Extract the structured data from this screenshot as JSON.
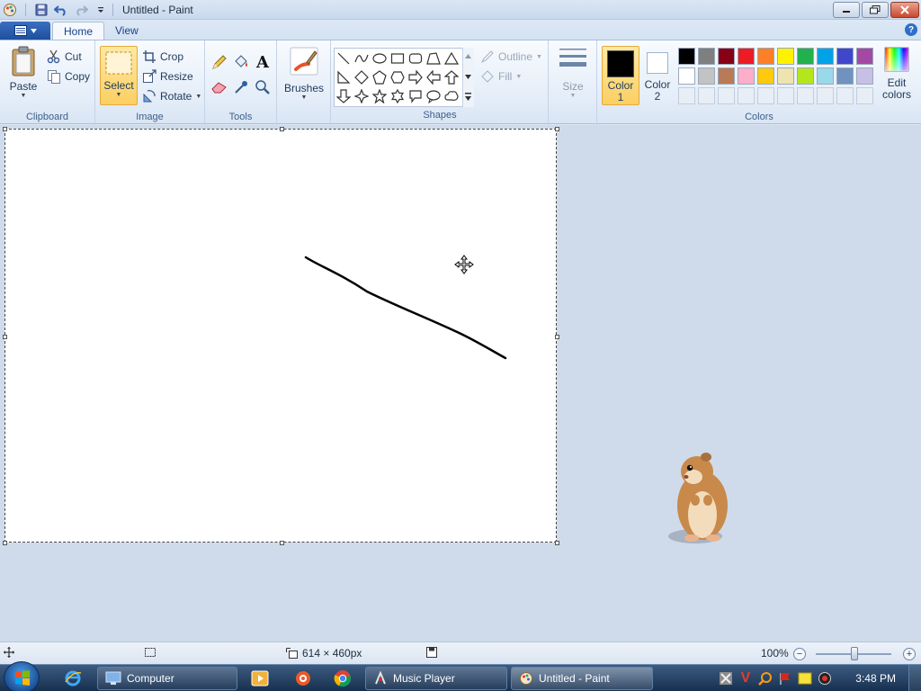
{
  "window": {
    "title": "Untitled - Paint"
  },
  "tabs": [
    {
      "label": "Home",
      "active": true
    },
    {
      "label": "View",
      "active": false
    }
  ],
  "ribbon": {
    "clipboard": {
      "group_label": "Clipboard",
      "paste": "Paste",
      "cut": "Cut",
      "copy": "Copy"
    },
    "image": {
      "group_label": "Image",
      "select": "Select",
      "crop": "Crop",
      "resize": "Resize",
      "rotate": "Rotate"
    },
    "tools": {
      "group_label": "Tools",
      "text_tool": "A"
    },
    "brushes": {
      "label": "Brushes"
    },
    "shapes": {
      "group_label": "Shapes",
      "outline": "Outline",
      "fill": "Fill"
    },
    "size": {
      "label": "Size"
    },
    "colors": {
      "group_label": "Colors",
      "color1_line1": "Color",
      "color1_line2": "1",
      "color2_line1": "Color",
      "color2_line2": "2",
      "edit_line1": "Edit",
      "edit_line2": "colors",
      "color1_value": "#000000",
      "color2_value": "#ffffff",
      "palette_row1": [
        "#000000",
        "#7f7f7f",
        "#880015",
        "#ed1c24",
        "#ff7f27",
        "#fff200",
        "#22b14c",
        "#00a2e8",
        "#3f48cc",
        "#a349a4"
      ],
      "palette_row2": [
        "#ffffff",
        "#c3c3c3",
        "#b97a57",
        "#ffaec9",
        "#ffc90e",
        "#efe4b0",
        "#b5e61d",
        "#99d9ea",
        "#7092be",
        "#c8bfe7"
      ]
    }
  },
  "status": {
    "canvas_size": "614 × 460px",
    "zoom": "100%",
    "zoom_minus": "−",
    "zoom_plus": "+"
  },
  "taskbar": {
    "tasks": [
      {
        "label": "Computer",
        "active": false
      },
      {
        "label": "Music Player",
        "active": false
      },
      {
        "label": "Untitled - Paint",
        "active": true
      }
    ],
    "clock": "3:48 PM"
  }
}
